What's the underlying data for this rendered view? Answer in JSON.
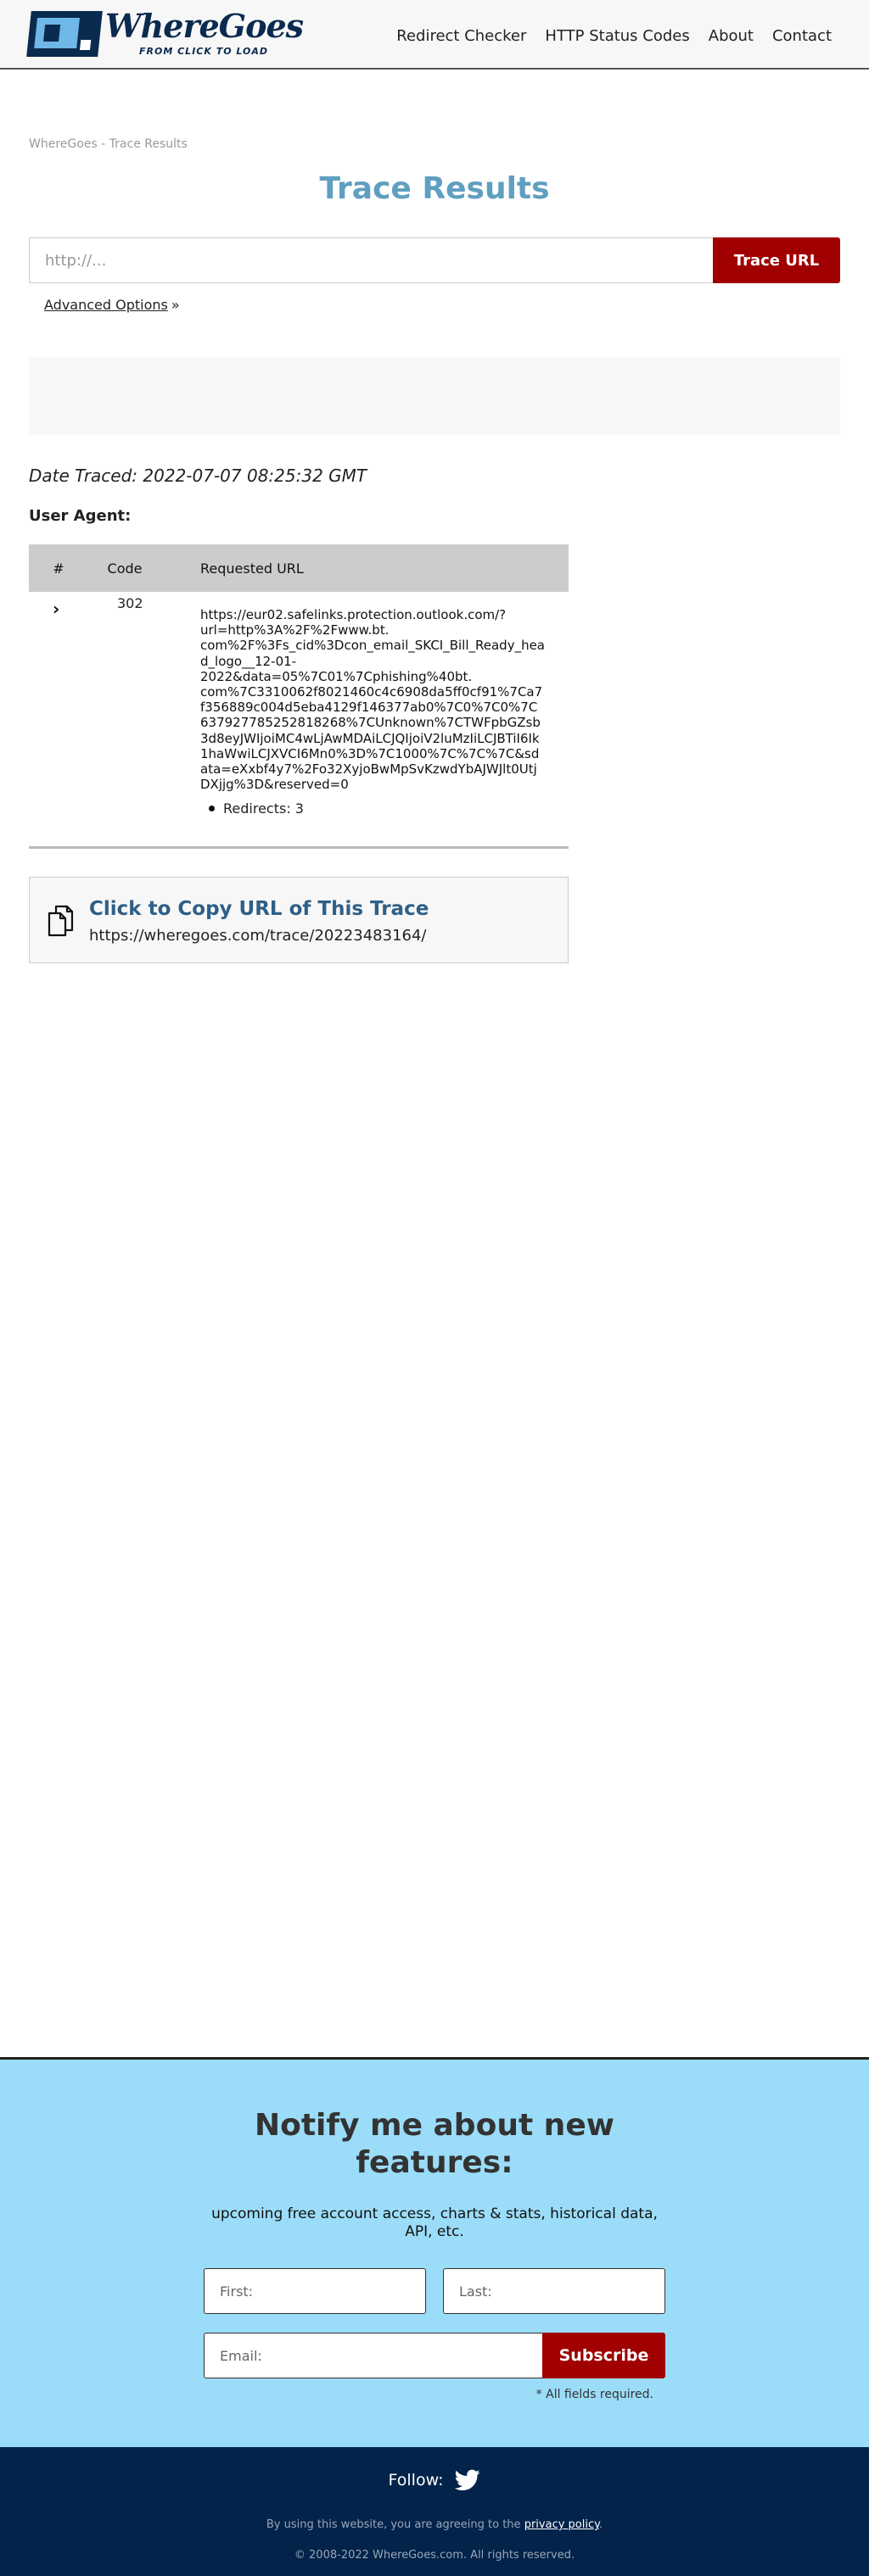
{
  "header": {
    "logo_name": "WhereGoes",
    "logo_tagline": "FROM CLICK TO LOAD",
    "nav": [
      {
        "label": "Redirect Checker"
      },
      {
        "label": "HTTP Status Codes"
      },
      {
        "label": "About"
      },
      {
        "label": "Contact"
      }
    ]
  },
  "main": {
    "breadcrumb": "WhereGoes - Trace Results",
    "title": "Trace Results",
    "search": {
      "placeholder": "http://...",
      "value": "",
      "button_label": "Trace URL"
    },
    "advanced_label": "Advanced Options",
    "advanced_chevron": "»",
    "date_traced": "Date Traced: 2022-07-07 08:25:32 GMT",
    "user_agent_label": "User Agent:",
    "table": {
      "headers": [
        "#",
        "Code",
        "Requested URL"
      ],
      "rows": [
        {
          "toggle": "›",
          "code": "302",
          "url_lines": [
            "https://eur02.safelinks.protection.outlook.com/?",
            "url=http%3A%2F%2Fwww.bt.",
            "com%2F%3Fs_cid%3Dcon_email_SKCI_Bill_Ready_hea",
            "d_logo__12-01-",
            "2022&data=05%7C01%7Cphishing%40bt.",
            "com%7C3310062f8021460c4c6908da5ff0cf91%7Ca7",
            "f356889c004d5eba4129f146377ab0%7C0%7C0%7C",
            "637927785252818268%7CUnknown%7CTWFpbGZsb",
            "3d8eyJWIjoiMC4wLjAwMDAiLCJQIjoiV2luMzIiLCJBTiI6Ik",
            "1haWwiLCJXVCI6Mn0%3D%7C1000%7C%7C%7C&sd",
            "ata=eXxbf4y7%2Fo32XyjoBwMpSvKzwdYbAJWJlt0Utj",
            "DXjjg%3D&reserved=0"
          ],
          "redirects": "Redirects: 3"
        }
      ]
    },
    "copy": {
      "title": "Click to Copy URL of This Trace",
      "url": "https://wheregoes.com/trace/20223483164/"
    }
  },
  "notify": {
    "title": "Notify me about new features:",
    "subtitle": "upcoming free account access, charts & stats, historical data, API, etc.",
    "first_placeholder": "First:",
    "last_placeholder": "Last:",
    "email_placeholder": "Email:",
    "subscribe_label": "Subscribe",
    "required_note": "* All fields required."
  },
  "footer": {
    "follow_label": "Follow:",
    "terms_prefix": "By using this website, you are agreeing to the",
    "privacy_link": "privacy policy",
    "terms_suffix": ".",
    "copyright": "© 2008-2022 WhereGoes.com. All rights reserved."
  },
  "colors": {
    "brand_navy": "#0b2a4f",
    "accent_red": "#a00000",
    "title_blue": "#5f9fc0",
    "notify_bg": "#9bdcf8",
    "footer_bg": "#03234a"
  }
}
